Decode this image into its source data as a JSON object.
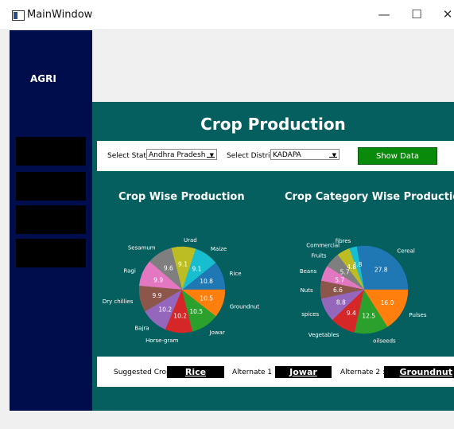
{
  "window": {
    "title": "MainWindow",
    "minimize": "—",
    "maximize": "☐",
    "close": "✕"
  },
  "sidebar": {
    "brand": "AGRI",
    "buttons": 4
  },
  "main": {
    "heading": "Crop Production",
    "filters": {
      "state_label": "Select Stat",
      "state_value": "Andhra Pradesh",
      "district_label": "Select Distric",
      "district_value": "KADAPA",
      "show_button": "Show Data"
    },
    "bottom": {
      "suggested_label": "Suggested Crop",
      "suggested_value": "Rice",
      "alt1_label": "Alternate 1 :",
      "alt1_value": "Jowar",
      "alt2_label": "Alternate 2 :",
      "alt2_value": "Groundnut"
    }
  },
  "chart_data": [
    {
      "type": "pie",
      "title": "Crop Wise Production S",
      "labels": [
        "Rice",
        "Maize",
        "Urad",
        "Sesamum",
        "Ragi",
        "Dry chillies",
        "Bajra",
        "Horse-gram",
        "Jowar",
        "Groundnut"
      ],
      "values": [
        10.8,
        9.1,
        9.1,
        9.6,
        9.9,
        9.9,
        10.2,
        10.2,
        10.5,
        10.5
      ],
      "colors": [
        "#1f77b4",
        "#17becf",
        "#bcbd22",
        "#7f7f7f",
        "#e377c2",
        "#8c564b",
        "#9467bd",
        "#d62728",
        "#2ca02c",
        "#ff7f0e"
      ]
    },
    {
      "type": "pie",
      "title": "Crop Category Wise Productio",
      "labels": [
        "Cereal",
        "fibres",
        "Commercial",
        "Fruits",
        "Beans",
        "Nuts",
        "spices",
        "Vegetables",
        "oilseeds",
        "Pulses"
      ],
      "values": [
        27.8,
        2.8,
        4.8,
        5.7,
        5.7,
        6.6,
        8.8,
        9.4,
        12.5,
        16.0
      ],
      "colors": [
        "#1f77b4",
        "#17becf",
        "#bcbd22",
        "#7f7f7f",
        "#e377c2",
        "#8c564b",
        "#9467bd",
        "#d62728",
        "#2ca02c",
        "#ff7f0e"
      ]
    }
  ]
}
